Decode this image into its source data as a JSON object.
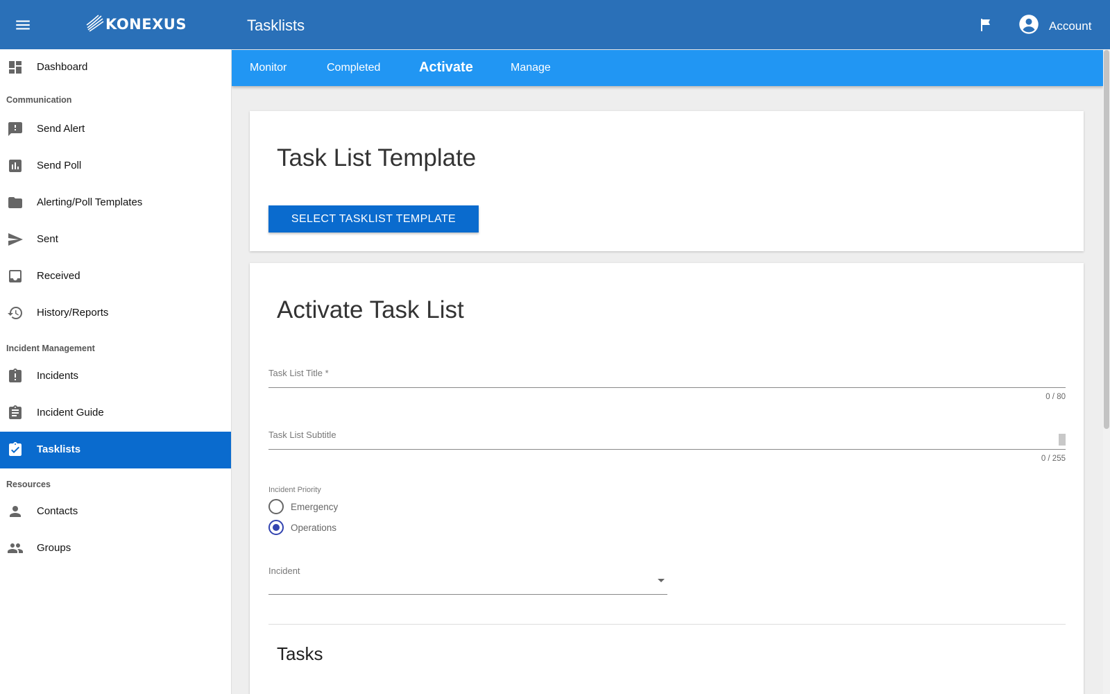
{
  "header": {
    "logo_text": "KONEXUS",
    "app_title": "Tasklists",
    "account_label": "Account",
    "icons": [
      "menu-icon",
      "konexus-logo-icon",
      "flag-icon",
      "account-circle-icon"
    ]
  },
  "colors": {
    "appbar": "#2a70b8",
    "subnav": "#2196f3",
    "primary": "#0a6bce",
    "radio_checked": "#3344b0"
  },
  "subnav": {
    "tabs": [
      {
        "label": "Monitor",
        "active": false
      },
      {
        "label": "Completed",
        "active": false
      },
      {
        "label": "Activate",
        "active": true
      },
      {
        "label": "Manage",
        "active": false
      }
    ]
  },
  "sidebar": {
    "dashboard": {
      "label": "Dashboard",
      "icon": "dashboard-icon"
    },
    "sections": [
      {
        "title": "Communication",
        "items": [
          {
            "label": "Send Alert",
            "icon": "feedback-icon"
          },
          {
            "label": "Send Poll",
            "icon": "poll-icon"
          },
          {
            "label": "Alerting/Poll Templates",
            "icon": "folder-icon"
          },
          {
            "label": "Sent",
            "icon": "send-icon"
          },
          {
            "label": "Received",
            "icon": "inbox-icon"
          },
          {
            "label": "History/Reports",
            "icon": "history-icon"
          }
        ]
      },
      {
        "title": "Incident Management",
        "items": [
          {
            "label": "Incidents",
            "icon": "incident-clipboard-icon"
          },
          {
            "label": "Incident Guide",
            "icon": "assignment-icon"
          },
          {
            "label": "Tasklists",
            "icon": "assignment-turned-in-icon",
            "active": true
          }
        ]
      },
      {
        "title": "Resources",
        "items": [
          {
            "label": "Contacts",
            "icon": "person-icon"
          },
          {
            "label": "Groups",
            "icon": "people-icon"
          }
        ]
      }
    ]
  },
  "template_card": {
    "title": "Task List Template",
    "button_label": "SELECT TASKLIST TEMPLATE"
  },
  "activate_card": {
    "title": "Activate Task List",
    "title_field": {
      "label": "Task List Title *",
      "value": "",
      "counter": "0 / 80"
    },
    "subtitle_field": {
      "label": "Task List Subtitle",
      "value": "",
      "counter": "0 / 255"
    },
    "priority": {
      "label": "Incident Priority",
      "options": [
        {
          "label": "Emergency",
          "checked": false
        },
        {
          "label": "Operations",
          "checked": true
        }
      ]
    },
    "incident_select": {
      "label": "Incident",
      "value": ""
    },
    "tasks_heading": "Tasks"
  }
}
